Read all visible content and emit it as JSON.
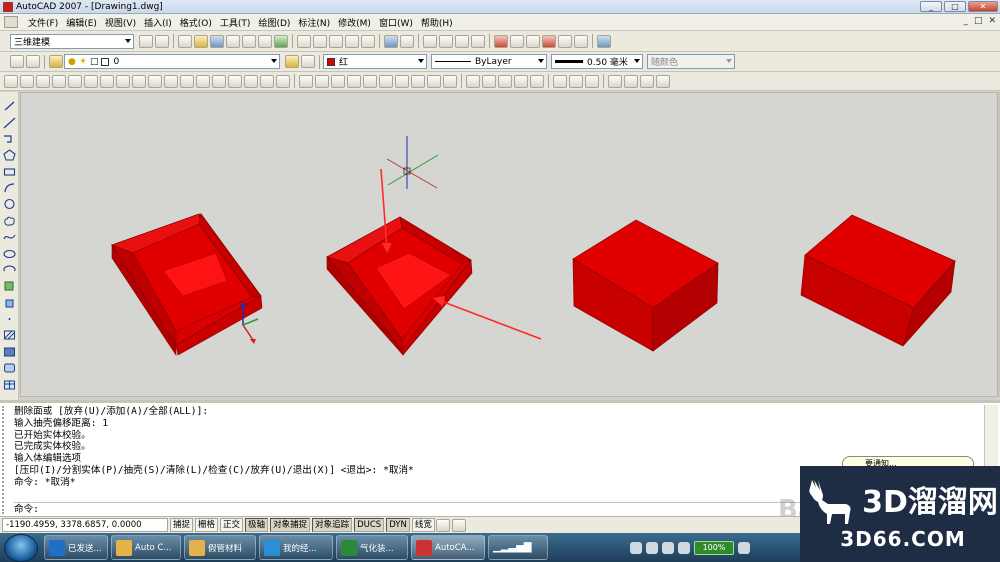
{
  "window": {
    "title": "AutoCAD 2007 - [Drawing1.dwg]",
    "min_label": "_",
    "max_label": "□",
    "close_label": "✕"
  },
  "menu": {
    "items": [
      "文件(F)",
      "编辑(E)",
      "视图(V)",
      "插入(I)",
      "格式(O)",
      "工具(T)",
      "绘图(D)",
      "标注(N)",
      "修改(M)",
      "窗口(W)",
      "帮助(H)"
    ],
    "mdi": [
      "_",
      "□",
      "✕"
    ]
  },
  "toolbar1": {
    "workspace": "三维建模"
  },
  "toolbar2": {
    "layer": "0",
    "color": "红",
    "color_hex": "#e00000",
    "linetype": "ByLayer",
    "lineweight": "0.50 毫米",
    "plotstyle": "随颜色"
  },
  "canvas": {
    "background": "#d5d6d2",
    "solid_color": "#e00000",
    "edge_color": "#a00000",
    "arrow_color": "#ff2a2a"
  },
  "command_history": [
    "删除面或 [放弃(U)/添加(A)/全部(ALL)]:",
    "输入抽壳偏移距离: 1",
    "已开始实体校验。",
    "已完成实体校验。",
    "输入体编辑选项",
    "[压印(I)/分割实体(P)/抽壳(S)/清除(L)/检查(C)/放弃(U)/退出(X)] <退出>: *取消*",
    "命令: *取消*"
  ],
  "command_prompt": "命令:",
  "watermark_text": "Bai",
  "statusbar": {
    "coords": "-1190.4959,  3378.6857,  0.0000",
    "buttons": [
      {
        "label": "捕捉",
        "on": false
      },
      {
        "label": "栅格",
        "on": false
      },
      {
        "label": "正交",
        "on": false
      },
      {
        "label": "极轴",
        "on": true
      },
      {
        "label": "对象捕捉",
        "on": true
      },
      {
        "label": "对象追踪",
        "on": true
      },
      {
        "label": "DUCS",
        "on": true
      },
      {
        "label": "DYN",
        "on": true
      },
      {
        "label": "线宽",
        "on": false
      }
    ]
  },
  "taskbar": {
    "tasks": [
      {
        "label": "已发送...",
        "color": "#1f6fc4"
      },
      {
        "label": "Auto C...",
        "color": "#e3b34a"
      },
      {
        "label": "假管材料",
        "color": "#e3b34a"
      },
      {
        "label": "我的经...",
        "color": "#2b8fd6"
      },
      {
        "label": "气化装...",
        "color": "#2a8a3a"
      },
      {
        "label": "AutoCA...",
        "color": "#c33"
      }
    ],
    "battery": "100%"
  },
  "tooltip": "要通知...",
  "logo": {
    "main": "3D溜溜网",
    "sub": "3D66.COM"
  }
}
